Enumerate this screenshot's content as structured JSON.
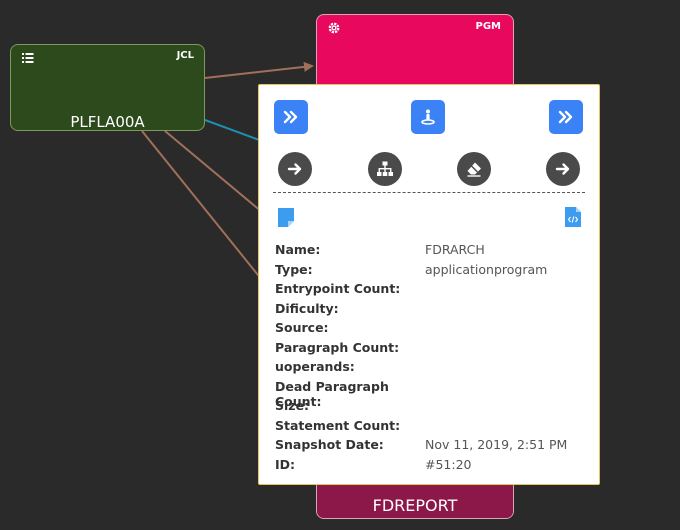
{
  "nodes": {
    "jcl": {
      "type_tag": "JCL",
      "label": "PLFLA00A",
      "icon": "list-icon"
    },
    "pgm": {
      "type_tag": "PGM",
      "label": "FDREPORT",
      "icon": "gear-icon"
    }
  },
  "popup": {
    "top_buttons": [
      {
        "icon": "double-chevron-right-icon"
      },
      {
        "icon": "person-pin-icon"
      },
      {
        "icon": "double-chevron-right-icon"
      }
    ],
    "circle_buttons": [
      {
        "icon": "arrow-right-icon"
      },
      {
        "icon": "sitemap-icon"
      },
      {
        "icon": "eraser-icon"
      },
      {
        "icon": "arrow-right-icon"
      }
    ],
    "file_icons": [
      "note-icon",
      "code-file-icon"
    ],
    "fields": {
      "name": {
        "label": "Name:",
        "value": "FDRARCH"
      },
      "type": {
        "label": "Type:",
        "value": "applicationprogram"
      },
      "entrypoint": {
        "label": "Entrypoint Count:",
        "value": ""
      },
      "dificulty": {
        "label": "Dificulty:",
        "value": ""
      },
      "source": {
        "label": "Source:",
        "value": ""
      },
      "paragraph_count": {
        "label": "Paragraph Count:",
        "value": ""
      },
      "uoperands": {
        "label": "uoperands:",
        "value": ""
      },
      "dead_paragraph": {
        "label": "Dead Paragraph Count:",
        "value": ""
      },
      "size": {
        "label": "Size:",
        "value": ""
      },
      "statement_count": {
        "label": "Statement Count:",
        "value": ""
      },
      "snapshot_date": {
        "label": "Snapshot Date:",
        "value": "Nov 11, 2019, 2:51 PM"
      },
      "id": {
        "label": "ID:",
        "value": "#51:20"
      }
    }
  },
  "colors": {
    "background": "#2a2a2a",
    "jcl_node": "#2d4a1c",
    "pgm_node": "#e8085e",
    "pgm_node_bottom": "#8c1749",
    "edge_brown": "#a0705a",
    "edge_teal": "#1f8fb0",
    "popup_border": "#e6c65a",
    "button_blue": "#3b82f6",
    "button_dark": "#4a4a4a"
  }
}
